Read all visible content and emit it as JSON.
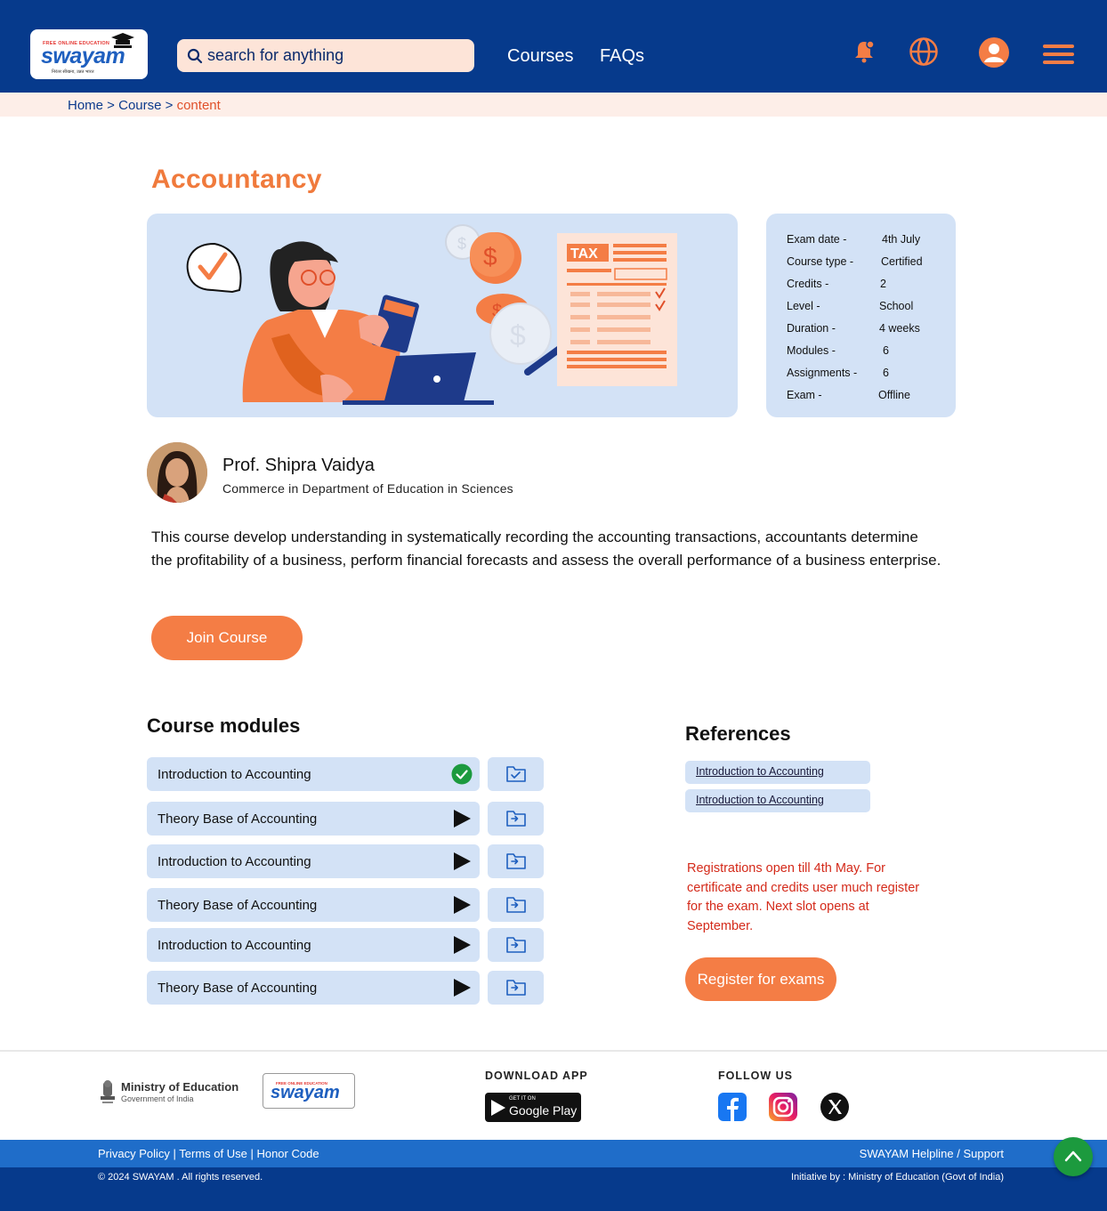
{
  "header": {
    "logo": {
      "tagline": "FREE ONLINE EDUCATION",
      "word": "swayam",
      "subtitle": "निरंतर सीखना, उन्नत भारत"
    },
    "search": {
      "placeholder": "search for anything"
    },
    "nav": [
      "Courses",
      "FAQs"
    ],
    "icons": [
      "notification-bell-icon",
      "globe-language-icon",
      "user-profile-icon",
      "hamburger-menu-icon"
    ]
  },
  "breadcrumb": {
    "home": "Home",
    "sep1": " > ",
    "course": "Course",
    "sep2": " > ",
    "current": "content"
  },
  "course": {
    "title": "Accountancy",
    "details": [
      {
        "key": "Exam date -",
        "value": "4th July"
      },
      {
        "key": "Course type -",
        "value": "Certified"
      },
      {
        "key": "Credits -",
        "value": "2"
      },
      {
        "key": "Level -",
        "value": "School"
      },
      {
        "key": "Duration -",
        "value": "4 weeks"
      },
      {
        "key": "Modules -",
        "value": "6"
      },
      {
        "key": "Assignments -",
        "value": "6"
      },
      {
        "key": "Exam -",
        "value": "Offline"
      }
    ],
    "hero_tax_label": "TAX",
    "professor": {
      "name": "Prof. Shipra Vaidya",
      "department": "Commerce in Department of Education in Sciences"
    },
    "description": "This course develop understanding in systematically recording the accounting transactions, accountants determine the profitability of a business, perform financial forecasts and assess the overall performance of a business enterprise.",
    "join_label": "Join Course"
  },
  "modules": {
    "title": "Course modules",
    "items": [
      {
        "label": "Introduction to Accounting",
        "status": "completed"
      },
      {
        "label": "Theory Base of Accounting",
        "status": "play"
      },
      {
        "label": "Introduction to Accounting",
        "status": "play"
      },
      {
        "label": "Theory Base of Accounting",
        "status": "play"
      },
      {
        "label": "Introduction to Accounting",
        "status": "play"
      },
      {
        "label": "Theory Base of Accounting",
        "status": "play"
      }
    ]
  },
  "references": {
    "title": "References",
    "items": [
      "Introduction to Accounting",
      "Introduction to Accounting"
    ]
  },
  "registration": {
    "notice": "Registrations open till 4th May. For certificate and credits user much register for the exam. Next slot opens at September.",
    "button": "Register for exams"
  },
  "footer": {
    "ministry": {
      "line1": "Ministry of Education",
      "line2": "Government of India"
    },
    "logo_word": "swayam",
    "logo_tagline": "FREE ONLINE EDUCATION",
    "download_label": "DOWNLOAD APP",
    "gplay_small": "GET IT ON",
    "gplay_big": "Google Play",
    "follow_label": "FOLLOW US",
    "links": "Privacy Policy | Terms of Use | Honor Code",
    "helpline": "SWAYAM Helpline / Support",
    "copyright": "© 2024 SWAYAM . All rights reserved.",
    "initiative": "Initiative by : Ministry of Education (Govt of India)"
  },
  "colors": {
    "primary_navy": "#063a8c",
    "accent_orange": "#f47d45",
    "panel_blue": "#d3e2f6",
    "notice_red": "#d42a1a",
    "success_green": "#1c9a3e"
  }
}
